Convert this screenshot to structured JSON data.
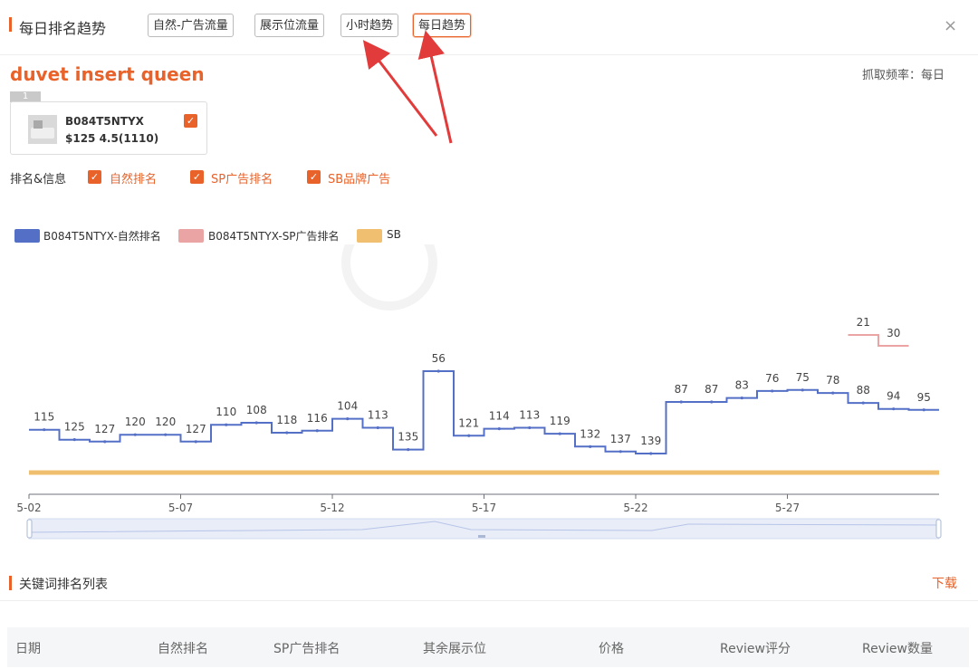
{
  "header": {
    "title": "每日排名趋势",
    "tabs": [
      {
        "label": "自然-广告流量",
        "active": false
      },
      {
        "label": "展示位流量",
        "active": false
      },
      {
        "label": "小时趋势",
        "active": false
      },
      {
        "label": "每日趋势",
        "active": true
      }
    ],
    "close_label": "×"
  },
  "keyword": "duvet insert queen",
  "frequency": "抓取频率：每日",
  "product": {
    "badge": "1",
    "asin": "B084T5NTYX",
    "price_rating": "$125 4.5(1110)",
    "checked": true
  },
  "filters": {
    "label": "排名&信息",
    "options": [
      {
        "label": "自然排名",
        "checked": true
      },
      {
        "label": "SP广告排名",
        "checked": true
      },
      {
        "label": "SB品牌广告",
        "checked": true
      }
    ]
  },
  "colors": {
    "accent": "#e8622a",
    "organic": "#5470c6",
    "sp": "#eaa4a4",
    "sb": "#f0c070"
  },
  "chart_data": {
    "type": "line",
    "step": true,
    "legend": [
      "B084T5NTYX-自然排名",
      "B084T5NTYX-SP广告排名",
      "SB"
    ],
    "x_ticks": [
      "5-02",
      "5-07",
      "5-12",
      "5-17",
      "5-22",
      "5-27"
    ],
    "categories": [
      "5-02",
      "5-03",
      "5-04",
      "5-05",
      "5-06",
      "5-07",
      "5-08",
      "5-09",
      "5-10",
      "5-11",
      "5-12",
      "5-13",
      "5-14",
      "5-15",
      "5-16",
      "5-17",
      "5-18",
      "5-19",
      "5-20",
      "5-21",
      "5-22",
      "5-23",
      "5-24",
      "5-25",
      "5-26",
      "5-27",
      "5-28",
      "5-29",
      "5-30",
      "5-31"
    ],
    "series": [
      {
        "name": "B084T5NTYX-自然排名",
        "values": [
          115,
          125,
          127,
          120,
          120,
          127,
          110,
          108,
          118,
          116,
          104,
          113,
          135,
          56,
          121,
          114,
          113,
          119,
          132,
          137,
          139,
          87,
          87,
          83,
          76,
          75,
          78,
          88,
          94,
          95
        ]
      },
      {
        "name": "B084T5NTYX-SP广告排名",
        "values": [
          null,
          null,
          null,
          null,
          null,
          null,
          null,
          null,
          null,
          null,
          null,
          null,
          null,
          null,
          null,
          null,
          null,
          null,
          null,
          null,
          null,
          null,
          null,
          null,
          null,
          null,
          null,
          21,
          30,
          null
        ]
      },
      {
        "name": "SB",
        "values": [
          150,
          150,
          150,
          150,
          150,
          150,
          150,
          150,
          150,
          150,
          150,
          150,
          150,
          150,
          150,
          150,
          150,
          150,
          150,
          150,
          150,
          150,
          150,
          150,
          150,
          150,
          150,
          150,
          150,
          150
        ]
      }
    ],
    "y_inverted": true,
    "ylim": [
      0,
      150
    ],
    "grid": false,
    "legend_position": "top-left"
  },
  "list_section": {
    "title": "关键词排名列表",
    "download_label": "下载",
    "columns": [
      "日期",
      "自然排名",
      "SP广告排名",
      "其余展示位",
      "价格",
      "Review评分",
      "Review数量"
    ]
  }
}
